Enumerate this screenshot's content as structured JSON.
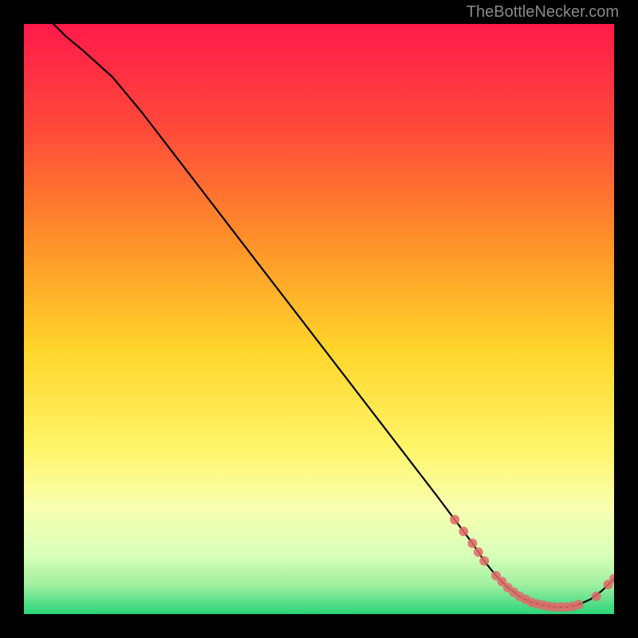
{
  "watermark": "TheBottleNecker.com",
  "chart_data": {
    "type": "line",
    "title": "",
    "xlabel": "",
    "ylabel": "",
    "xlim": [
      0,
      100
    ],
    "ylim": [
      0,
      100
    ],
    "background_gradient": {
      "top": "#ff1a4a",
      "mid_upper": "#ff9a2a",
      "mid": "#ffe92a",
      "mid_lower": "#f5ff8a",
      "lower": "#d8ffb8",
      "bottom": "#2bd47a"
    },
    "series": [
      {
        "name": "bottleneck-curve",
        "type": "line",
        "color": "#000000",
        "x": [
          5,
          7,
          10,
          15,
          20,
          25,
          30,
          35,
          40,
          45,
          50,
          55,
          60,
          65,
          70,
          73,
          76,
          78,
          80,
          82,
          84,
          86,
          88,
          90,
          92,
          94,
          96,
          98,
          100
        ],
        "y": [
          100,
          98,
          95.5,
          91,
          85,
          78.5,
          72,
          65.5,
          59,
          52.5,
          46,
          39.5,
          33,
          26.5,
          20,
          16,
          12,
          9,
          6.5,
          4.5,
          3,
          2,
          1.5,
          1.2,
          1.2,
          1.6,
          2.5,
          4,
          6
        ]
      },
      {
        "name": "highlight-dots-upper",
        "type": "scatter",
        "color": "#e06a6a",
        "x": [
          73,
          74.5,
          76,
          77,
          78
        ],
        "y": [
          16,
          14,
          12,
          10.5,
          9
        ]
      },
      {
        "name": "highlight-dots-cluster",
        "type": "scatter",
        "color": "#e06a6a",
        "x": [
          80,
          81,
          82,
          83,
          84,
          85,
          86,
          87,
          88,
          89,
          90,
          91,
          92,
          93,
          94
        ],
        "y": [
          6.5,
          5.5,
          4.5,
          3.7,
          3,
          2.5,
          2,
          1.7,
          1.5,
          1.3,
          1.2,
          1.2,
          1.2,
          1.3,
          1.6
        ]
      },
      {
        "name": "highlight-dots-rise",
        "type": "scatter",
        "color": "#e06a6a",
        "x": [
          97,
          99,
          100
        ],
        "y": [
          3,
          5,
          6
        ]
      }
    ]
  }
}
